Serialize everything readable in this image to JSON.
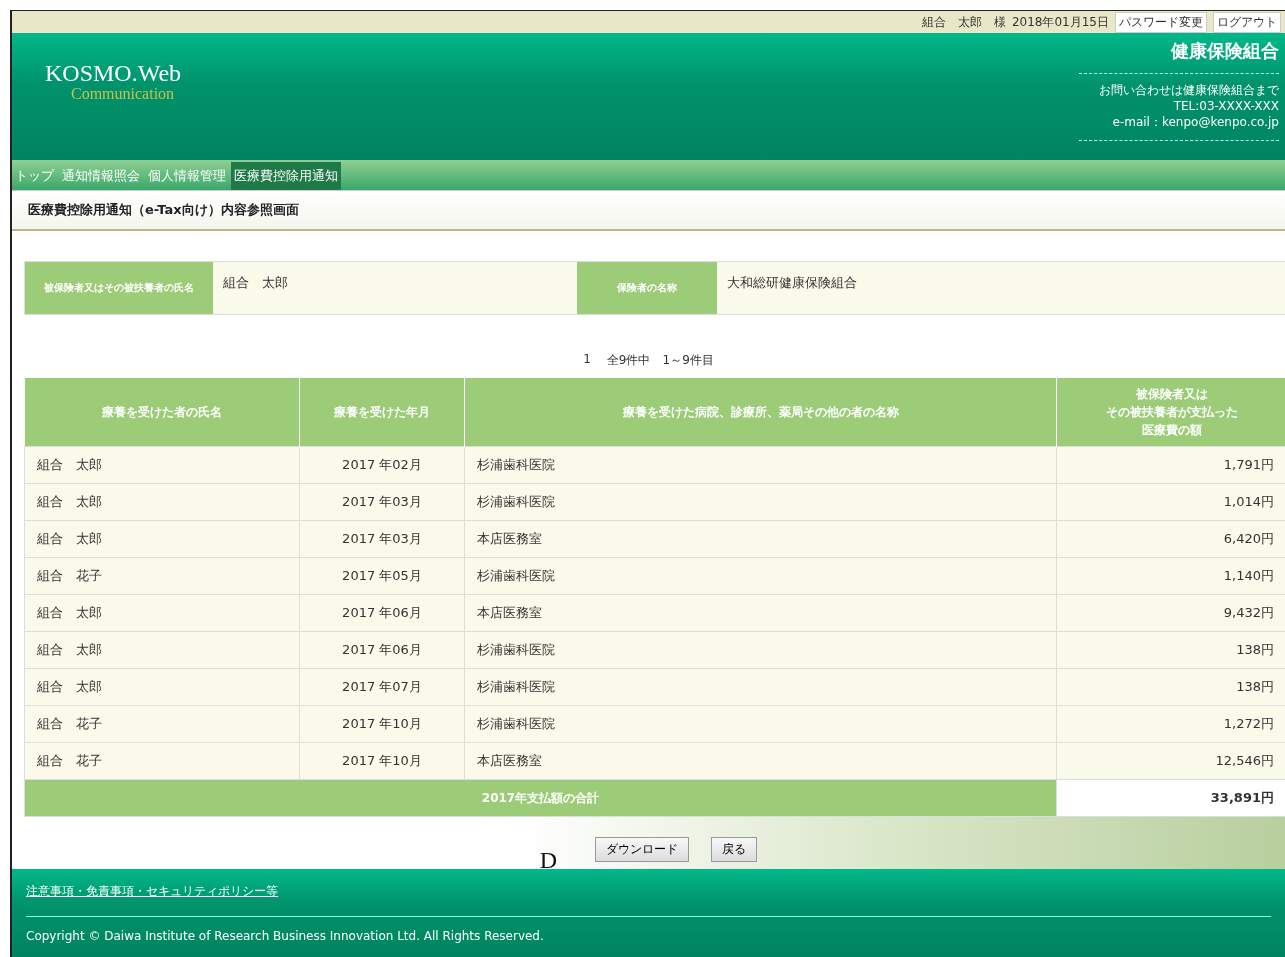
{
  "top_bar": {
    "user": "組合　太郎　様",
    "date": "2018年01月15日",
    "links": [
      "パスワード変更",
      "ログアウト"
    ]
  },
  "header": {
    "logo_main": "KOSMO.Web",
    "logo_sub": "Communication",
    "org": "健康保険組合",
    "contact": [
      "お問い合わせは健康保険組合まで",
      "TEL:03-XXXX-XXX",
      "e-mail：kenpo@kenpo.co.jp"
    ]
  },
  "tabs": [
    {
      "label": "トップ",
      "selected": false
    },
    {
      "label": "通知情報照会",
      "selected": false
    },
    {
      "label": "個人情報管理",
      "selected": false
    },
    {
      "label": "医療費控除用通知",
      "selected": true
    }
  ],
  "page_title": "医療費控除用通知（e-Tax向け）内容参照画面",
  "info": [
    {
      "label": "被保険者又はその被扶養者の氏名",
      "value": "組合　太郎"
    },
    {
      "label": "保険者の名称",
      "value": "大和総研健康保険組合"
    }
  ],
  "pagination": {
    "page": "1",
    "summary": "全9件中　1～9件目"
  },
  "table": {
    "columns": [
      "療養を受けた者の氏名",
      "療養を受けた年月",
      "療養を受けた病院、診療所、薬局その他の者の名称",
      [
        "被保険者又は",
        "その被扶養者が支払った",
        "医療費の額"
      ]
    ],
    "rows": [
      [
        "組合　太郎",
        "2017 年02月",
        "杉浦歯科医院",
        "1,791円"
      ],
      [
        "組合　太郎",
        "2017 年03月",
        "杉浦歯科医院",
        "1,014円"
      ],
      [
        "組合　太郎",
        "2017 年03月",
        "本店医務室",
        "6,420円"
      ],
      [
        "組合　花子",
        "2017 年05月",
        "杉浦歯科医院",
        "1,140円"
      ],
      [
        "組合　太郎",
        "2017 年06月",
        "本店医務室",
        "9,432円"
      ],
      [
        "組合　太郎",
        "2017 年06月",
        "杉浦歯科医院",
        "138円"
      ],
      [
        "組合　太郎",
        "2017 年07月",
        "杉浦歯科医院",
        "138円"
      ],
      [
        "組合　花子",
        "2017 年10月",
        "杉浦歯科医院",
        "1,272円"
      ],
      [
        "組合　花子",
        "2017 年10月",
        "本店医務室",
        "12,546円"
      ]
    ],
    "total_label": "2017年支払額の合計",
    "total_value": "33,891円"
  },
  "buttons": [
    "ダウンロード",
    "戻る"
  ],
  "stray_mark": "D",
  "footer": {
    "link": "注意事項・免責事項・セキュリティポリシー等",
    "copyright": "Copyright © Daiwa Institute of Research Business Innovation Ltd. All Rights Reserved."
  }
}
